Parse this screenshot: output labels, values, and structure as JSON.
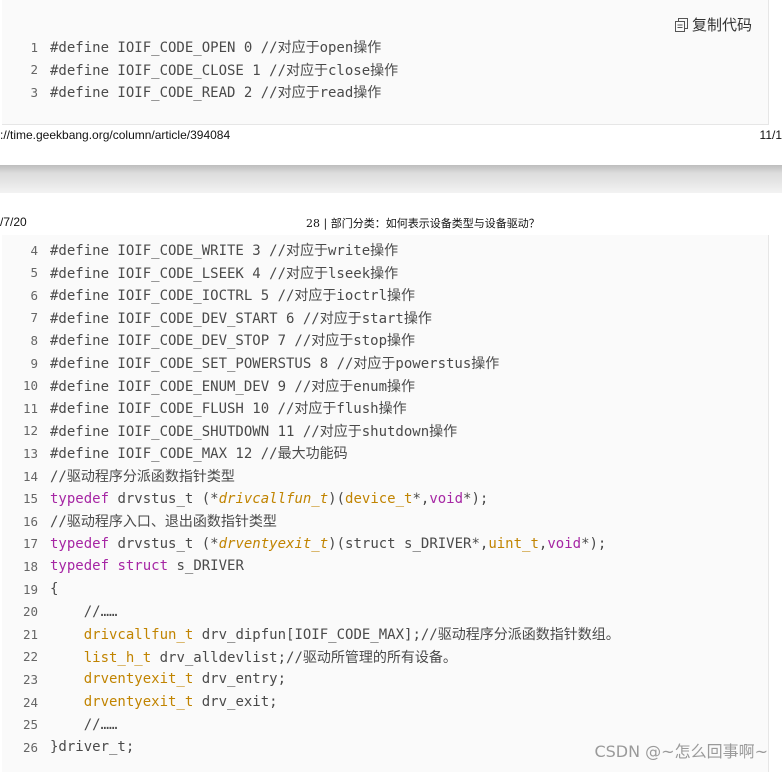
{
  "top_page": {
    "copy_label": "复制代码",
    "lines": [
      {
        "num": "1",
        "text": "#define IOIF_CODE_OPEN 0 //对应于open操作"
      },
      {
        "num": "2",
        "text": "#define IOIF_CODE_CLOSE 1 //对应于close操作"
      },
      {
        "num": "3",
        "text": "#define IOIF_CODE_READ 2 //对应于read操作"
      }
    ],
    "footer_url": "://time.geekbang.org/column/article/394084",
    "footer_page": "11/1"
  },
  "bottom_page": {
    "header_date": "/7/20",
    "header_title": "28 | 部门分类：如何表示设备类型与设备驱动？",
    "lines": [
      {
        "num": "4",
        "parts": [
          {
            "t": "#define IOIF_CODE_WRITE 3 //对应于write操作"
          }
        ]
      },
      {
        "num": "5",
        "parts": [
          {
            "t": "#define IOIF_CODE_LSEEK 4 //对应于lseek操作"
          }
        ]
      },
      {
        "num": "6",
        "parts": [
          {
            "t": "#define IOIF_CODE_IOCTRL 5 //对应于ioctrl操作"
          }
        ]
      },
      {
        "num": "7",
        "parts": [
          {
            "t": "#define IOIF_CODE_DEV_START 6 //对应于start操作"
          }
        ]
      },
      {
        "num": "8",
        "parts": [
          {
            "t": "#define IOIF_CODE_DEV_STOP 7 //对应于stop操作"
          }
        ]
      },
      {
        "num": "9",
        "parts": [
          {
            "t": "#define IOIF_CODE_SET_POWERSTUS 8 //对应于powerstus操作"
          }
        ]
      },
      {
        "num": "10",
        "parts": [
          {
            "t": "#define IOIF_CODE_ENUM_DEV 9 //对应于enum操作"
          }
        ]
      },
      {
        "num": "11",
        "parts": [
          {
            "t": "#define IOIF_CODE_FLUSH 10 //对应于flush操作"
          }
        ]
      },
      {
        "num": "12",
        "parts": [
          {
            "t": "#define IOIF_CODE_SHUTDOWN 11 //对应于shutdown操作"
          }
        ]
      },
      {
        "num": "13",
        "parts": [
          {
            "t": "#define IOIF_CODE_MAX 12 //最大功能码"
          }
        ]
      },
      {
        "num": "14",
        "parts": [
          {
            "t": "//驱动程序分派函数指针类型"
          }
        ]
      },
      {
        "num": "15",
        "parts": [
          {
            "t": "typedef",
            "c": "kw"
          },
          {
            "t": " drvstus_t (*"
          },
          {
            "t": "drivcallfun_t",
            "c": "fn"
          },
          {
            "t": ")("
          },
          {
            "t": "device_t",
            "c": "ty"
          },
          {
            "t": "*,"
          },
          {
            "t": "void",
            "c": "kw"
          },
          {
            "t": "*);"
          }
        ]
      },
      {
        "num": "16",
        "parts": [
          {
            "t": "//驱动程序入口、退出函数指针类型"
          }
        ]
      },
      {
        "num": "17",
        "parts": [
          {
            "t": "typedef",
            "c": "kw"
          },
          {
            "t": " drvstus_t (*"
          },
          {
            "t": "drventyexit_t",
            "c": "fn"
          },
          {
            "t": ")(struct s_DRIVER*,"
          },
          {
            "t": "uint_t",
            "c": "ty"
          },
          {
            "t": ","
          },
          {
            "t": "void",
            "c": "kw"
          },
          {
            "t": "*);"
          }
        ]
      },
      {
        "num": "18",
        "parts": [
          {
            "t": "typedef",
            "c": "kw"
          },
          {
            "t": " "
          },
          {
            "t": "struct",
            "c": "kw"
          },
          {
            "t": " s_DRIVER"
          }
        ]
      },
      {
        "num": "19",
        "parts": [
          {
            "t": "{"
          }
        ]
      },
      {
        "num": "20",
        "parts": [
          {
            "t": "    //……"
          }
        ]
      },
      {
        "num": "21",
        "parts": [
          {
            "t": "    "
          },
          {
            "t": "drivcallfun_t",
            "c": "ty"
          },
          {
            "t": " drv_dipfun[IOIF_CODE_MAX];//驱动程序分派函数指针数组。"
          }
        ]
      },
      {
        "num": "22",
        "parts": [
          {
            "t": "    "
          },
          {
            "t": "list_h_t",
            "c": "ty"
          },
          {
            "t": " drv_alldevlist;//驱动所管理的所有设备。"
          }
        ]
      },
      {
        "num": "23",
        "parts": [
          {
            "t": "    "
          },
          {
            "t": "drventyexit_t",
            "c": "ty"
          },
          {
            "t": " drv_entry;"
          }
        ]
      },
      {
        "num": "24",
        "parts": [
          {
            "t": "    "
          },
          {
            "t": "drventyexit_t",
            "c": "ty"
          },
          {
            "t": " drv_exit;"
          }
        ]
      },
      {
        "num": "25",
        "parts": [
          {
            "t": "    //……"
          }
        ]
      },
      {
        "num": "26",
        "parts": [
          {
            "t": "}driver_t;"
          }
        ]
      }
    ]
  },
  "watermark": "CSDN @~怎么回事啊~",
  "colors": {
    "keyword": "#a626a4",
    "type": "#c18401",
    "text": "#4a4a4a",
    "line_number": "#666666",
    "code_bg": "#fafafa"
  },
  "icons": {
    "copy": "copy-icon"
  }
}
